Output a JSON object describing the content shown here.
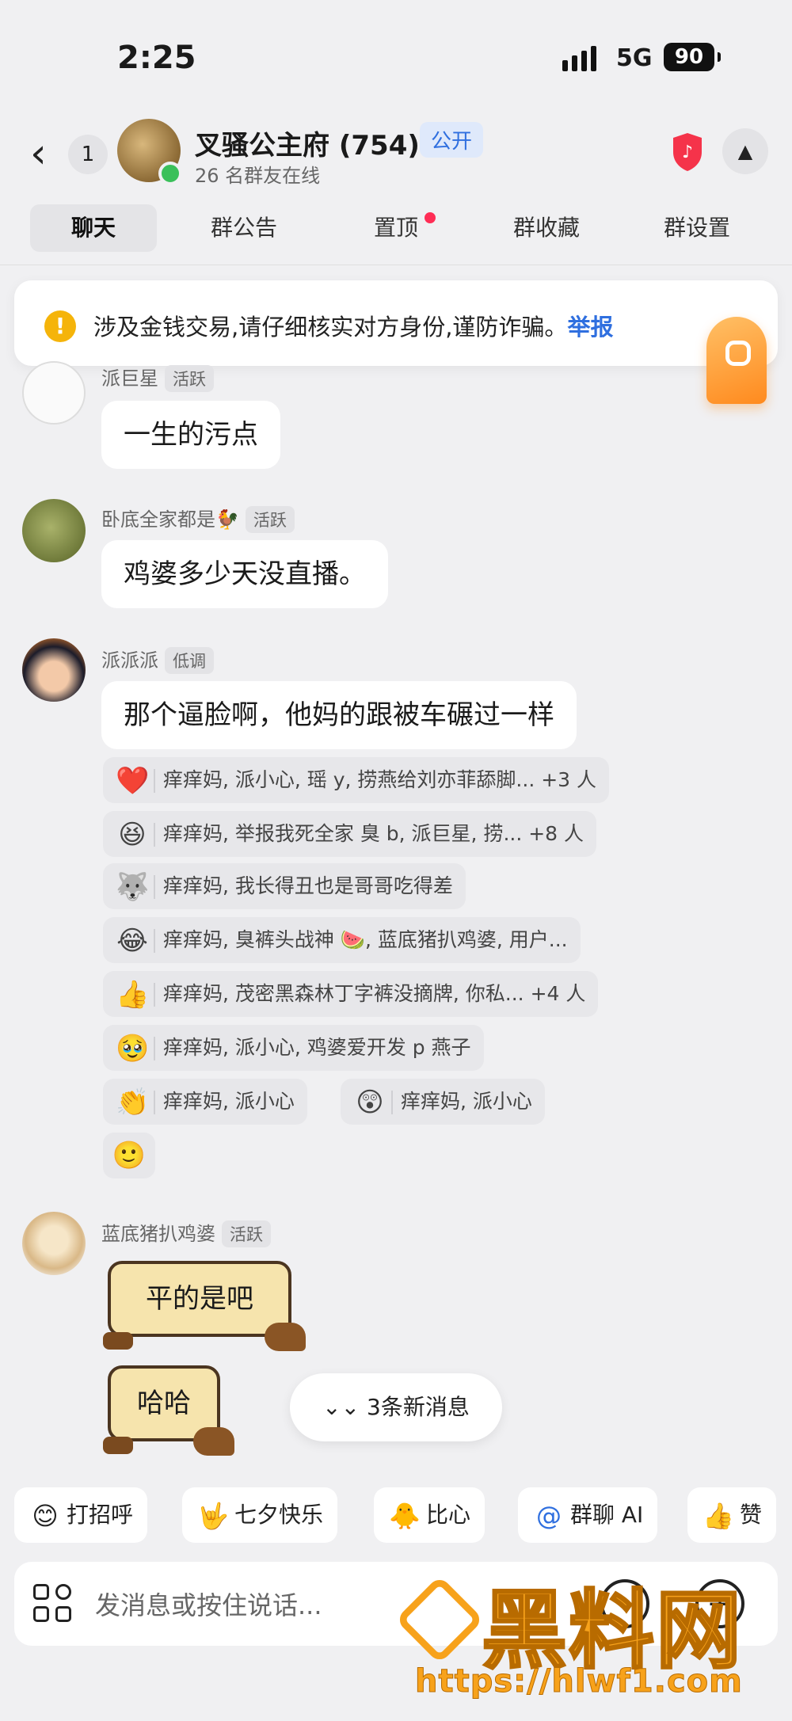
{
  "status": {
    "time": "2:25",
    "network": "5G",
    "battery": "90"
  },
  "header": {
    "back_count": "1",
    "group_name": "叉骚公主府 (754)",
    "group_badge": "公开",
    "online": "26 名群友在线"
  },
  "tabs": [
    "聊天",
    "群公告",
    "置顶",
    "群收藏",
    "群设置"
  ],
  "notice": {
    "text": "涉及金钱交易,请仔细核实对方身份,谨防诈骗。",
    "link": "举报"
  },
  "messages": [
    {
      "user": "派巨星",
      "tag": "活跃",
      "text": "一生的污点"
    },
    {
      "user": "卧底全家都是🐓",
      "tag": "活跃",
      "text": "鸡婆多少天没直播。"
    },
    {
      "user": "派派派",
      "tag": "低调",
      "text": "那个逼脸啊，他妈的跟被车碾过一样"
    },
    {
      "user": "蓝底猪扒鸡婆",
      "tag": "活跃",
      "stickers": [
        "平的是吧",
        "哈哈"
      ]
    }
  ],
  "reactions": [
    {
      "emoji": "❤️",
      "users": "痒痒妈, 派小心, 瑶 y, 捞燕给刘亦菲舔脚... +3 人"
    },
    {
      "emoji": "😆",
      "users": "痒痒妈, 举报我死全家 臭 b, 派巨星, 捞... +8 人"
    },
    {
      "emoji": "🐺",
      "users": "痒痒妈, 我长得丑也是哥哥吃得差"
    },
    {
      "emoji": "😂",
      "users": "痒痒妈, 臭裤头战神 🍉, 蓝底猪扒鸡婆, 用户..."
    },
    {
      "emoji": "👍",
      "users": "痒痒妈, 茂密黑森林丁字裤没摘牌, 你私... +4 人"
    },
    {
      "emoji": "🥹",
      "users": "痒痒妈, 派小心, 鸡婆爱开发 p 燕子"
    },
    {
      "emoji": "👏",
      "users": "痒痒妈, 派小心"
    },
    {
      "emoji": "😲",
      "users": "痒痒妈, 派小心"
    }
  ],
  "add_reaction_icon": "🙂",
  "new_messages": "3条新消息",
  "quick_replies": [
    {
      "icon": "😊",
      "label": "打招呼"
    },
    {
      "icon": "🤟",
      "label": "七夕快乐"
    },
    {
      "icon": "🐥",
      "label": "比心"
    },
    {
      "icon": "@",
      "label": "群聊 AI"
    },
    {
      "icon": "👍",
      "label": "赞"
    }
  ],
  "input": {
    "placeholder": "发消息或按住说话..."
  },
  "watermark": {
    "text": "黑料网",
    "url": "https://hlwf1.com"
  },
  "colors": {
    "accent": "#2f6fdf",
    "warning": "#f5b40a",
    "online": "#3ac05a",
    "badge_dot": "#ff2d55",
    "watermark": "#f7a21b"
  }
}
